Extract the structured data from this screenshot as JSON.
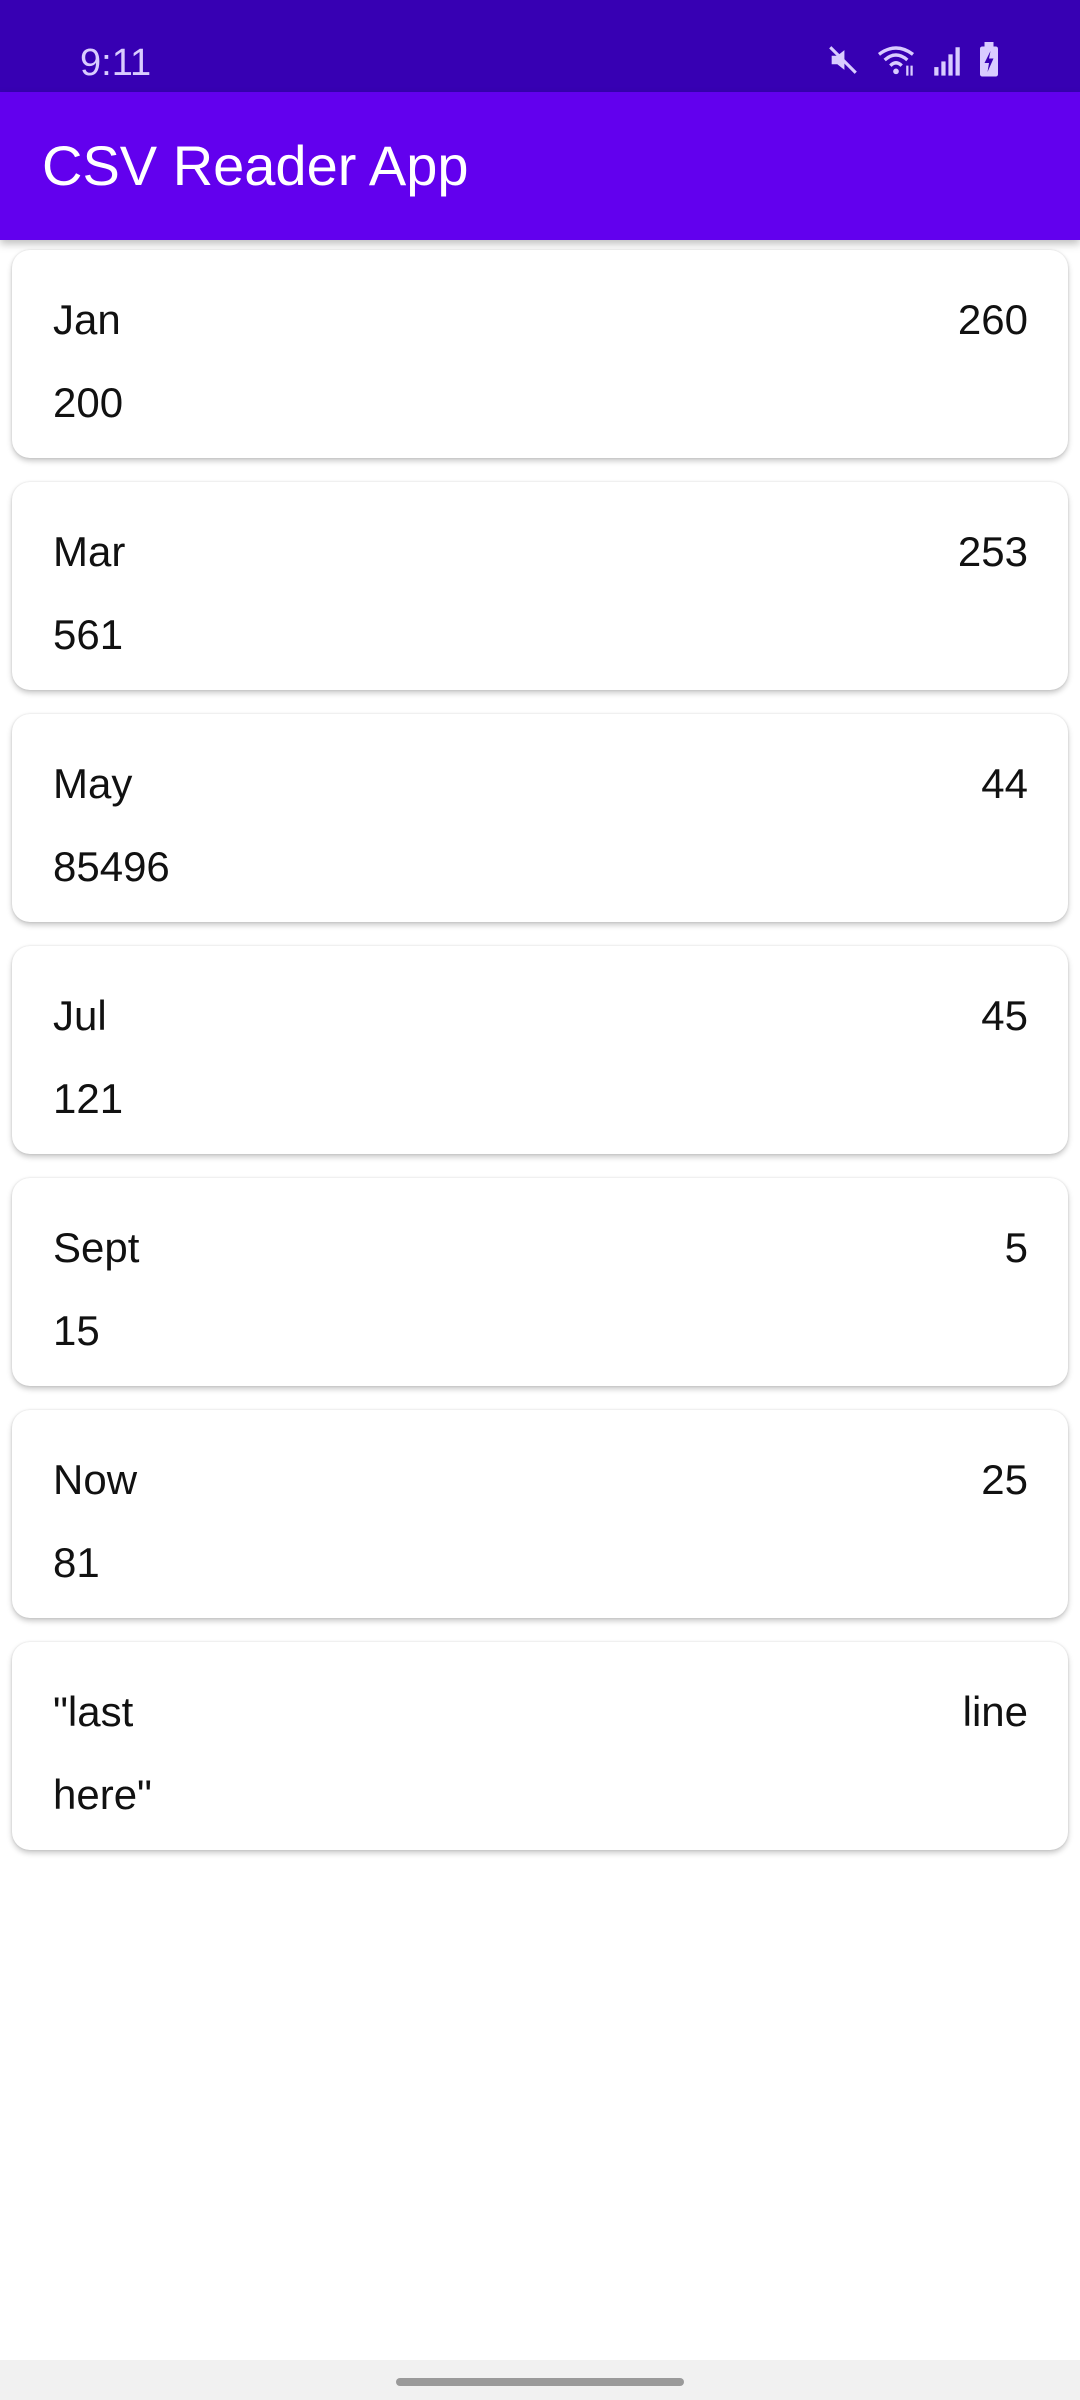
{
  "status_bar": {
    "time": "9:11",
    "icons": [
      "mute-icon",
      "wifi-icon",
      "signal-icon",
      "battery-icon"
    ],
    "color": "#3700b3"
  },
  "app_bar": {
    "title": "CSV Reader App",
    "color": "#6200ee"
  },
  "rows": [
    {
      "left": "Jan",
      "right": "260",
      "bottom": "200"
    },
    {
      "left": "Mar",
      "right": "253",
      "bottom": "561"
    },
    {
      "left": "May",
      "right": "44",
      "bottom": "85496"
    },
    {
      "left": "Jul",
      "right": "45",
      "bottom": "121"
    },
    {
      "left": "Sept",
      "right": "5",
      "bottom": "15"
    },
    {
      "left": "Now",
      "right": "25",
      "bottom": "81"
    },
    {
      "left": "\"last",
      "right": "line",
      "bottom": "here\""
    }
  ]
}
